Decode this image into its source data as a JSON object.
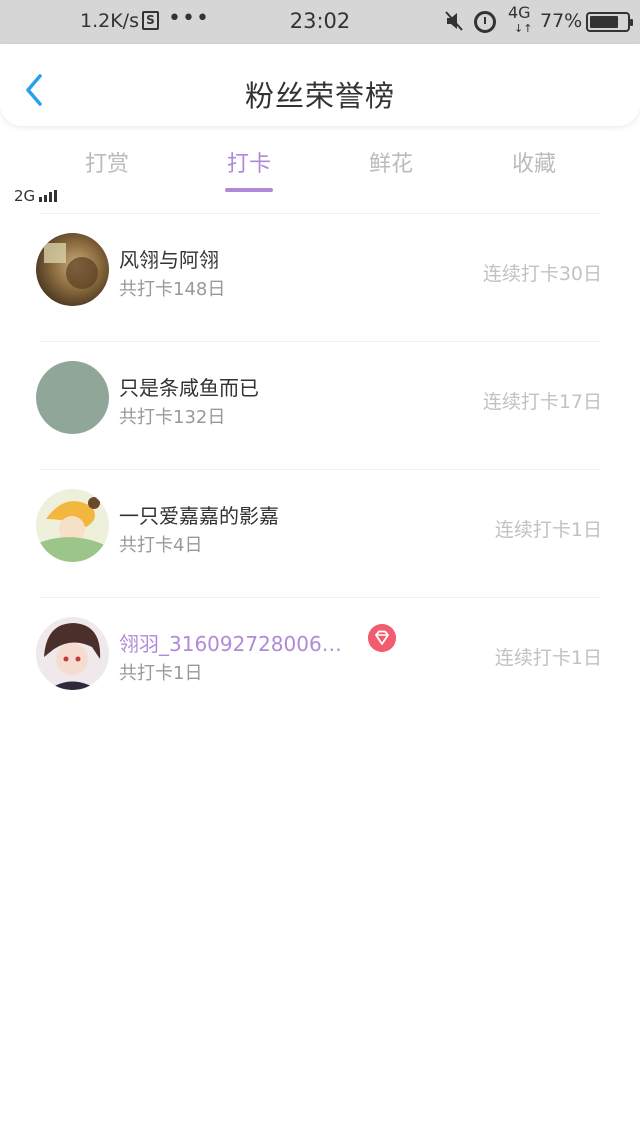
{
  "status_bar": {
    "net1": "4G",
    "net2": "2G",
    "speed": "1.2K/s",
    "s_icon": "S",
    "dots": "•••",
    "time": "23:02",
    "net3": "4G",
    "battery": "77%",
    "battery_level": 0.77
  },
  "header": {
    "title": "粉丝荣誉榜",
    "back_icon": "chevron-left-icon",
    "accent": "#29a0ec"
  },
  "tabs": {
    "active_color": "#b08ad8",
    "items": [
      {
        "label": "打赏"
      },
      {
        "label": "打卡"
      },
      {
        "label": "鲜花"
      },
      {
        "label": "收藏"
      }
    ],
    "active_index": 1
  },
  "fans": [
    {
      "name": "风翎与阿翎",
      "total": "共打卡148日",
      "streak": "连续打卡30日"
    },
    {
      "name": "只是条咸鱼而已",
      "total": "共打卡132日",
      "streak": "连续打卡17日"
    },
    {
      "name": "一只爱嘉嘉的影嘉",
      "total": "共打卡4日",
      "streak": "连续打卡1日"
    },
    {
      "name": "翎羽_316092728006…",
      "total": "共打卡1日",
      "streak": "连续打卡1日",
      "badge": "diamond-icon"
    }
  ]
}
